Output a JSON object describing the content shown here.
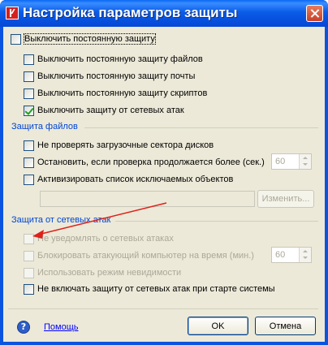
{
  "window": {
    "title": "Настройка параметров защиты"
  },
  "options": {
    "disable_all": "Выключить постоянную защиту",
    "disable_files": "Выключить постоянную защиту файлов",
    "disable_mail": "Выключить постоянную защиту почты",
    "disable_scripts": "Выключить постоянную защиту скриптов",
    "disable_network": "Выключить защиту от сетевых атак"
  },
  "file_protection": {
    "heading": "Защита файлов",
    "skip_boot": "Не проверять загрузочные сектора дисков",
    "stop_if_long": "Остановить, если проверка продолжается более (сек.)",
    "stop_seconds": "60",
    "enable_exclusions": "Активизировать список исключаемых объектов",
    "change_button": "Изменить..."
  },
  "network_protection": {
    "heading": "Защита от сетевых атак",
    "no_notify": "Не уведомлять о сетевых атаках",
    "block_attacker": "Блокировать атакующий компьютер на время (мин.)",
    "block_minutes": "60",
    "stealth_mode": "Использовать режим невидимости",
    "no_start": "Не включать защиту от сетевых атак при старте системы"
  },
  "footer": {
    "help_label": "Помощь",
    "ok_label": "OK",
    "cancel_label": "Отмена"
  },
  "state": {
    "disable_all": false,
    "disable_files": false,
    "disable_mail": false,
    "disable_scripts": false,
    "disable_network": true,
    "skip_boot": false,
    "stop_if_long": false,
    "enable_exclusions": false,
    "no_notify": false,
    "block_attacker": false,
    "stealth_mode": false,
    "no_start": false
  },
  "colors": {
    "title_bar": "#0a5ce8",
    "dialog_bg": "#ece9d8",
    "section_heading": "#0046d5",
    "annotation_arrow": "#e0201a",
    "close_button": "#c6412a"
  },
  "icons": {
    "app": "kaspersky-k-icon",
    "close": "close-icon",
    "help": "help-question-icon"
  }
}
